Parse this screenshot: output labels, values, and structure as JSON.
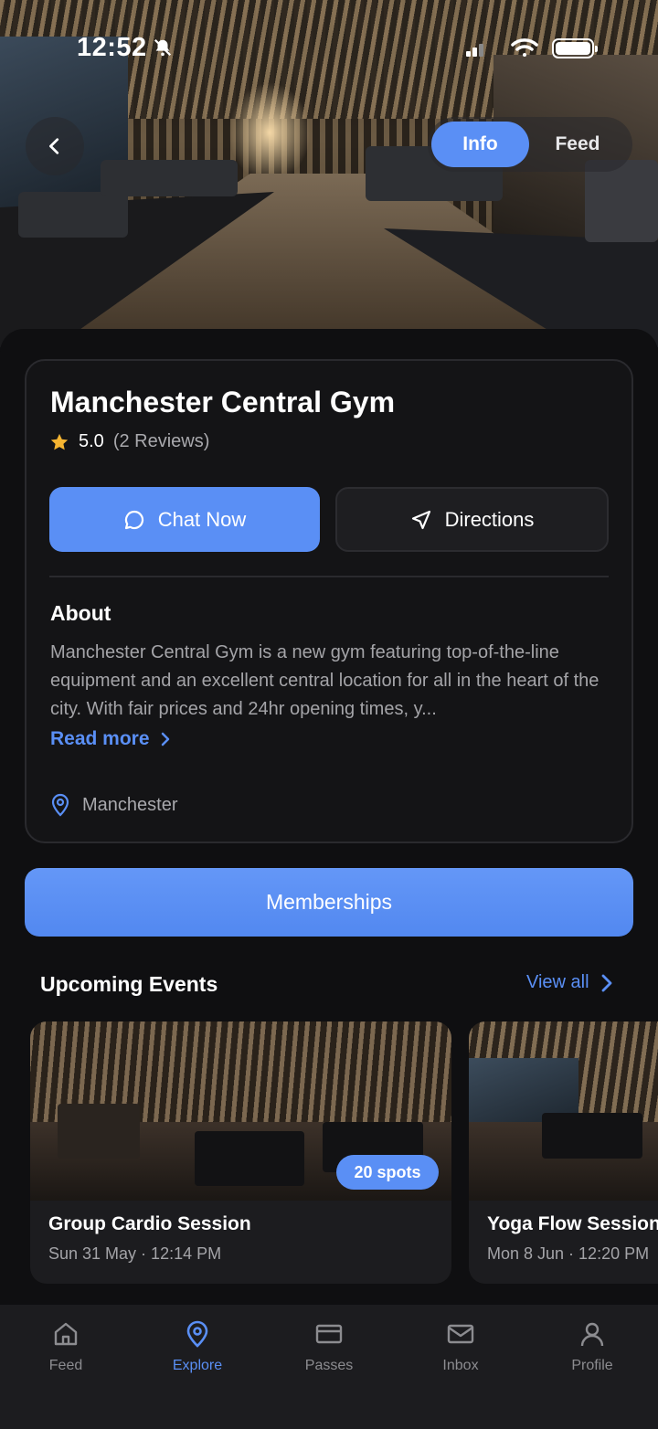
{
  "status_bar": {
    "time": "12:52"
  },
  "header": {
    "tabs": [
      {
        "label": "Info",
        "active": true
      },
      {
        "label": "Feed",
        "active": false
      }
    ]
  },
  "gym": {
    "name": "Manchester Central Gym",
    "rating": "5.0",
    "reviews": "(2 Reviews)",
    "chat_label": "Chat Now",
    "directions_label": "Directions",
    "about_title": "About",
    "about_text": "Manchester Central Gym is a new gym featuring top-of-the-line equipment and an excellent central location for all in the heart of the city. With fair prices and 24hr opening times, y...",
    "read_more": "Read more",
    "location": "Manchester"
  },
  "memberships_label": "Memberships",
  "events": {
    "title": "Upcoming Events",
    "view_all": "View all",
    "items": [
      {
        "title": "Group Cardio Session",
        "date": "Sun 31 May · 12:14 PM",
        "spots": "20 spots"
      },
      {
        "title": "Yoga Flow Session",
        "date": "Mon 8 Jun · 12:20 PM"
      }
    ]
  },
  "nav": [
    {
      "label": "Feed",
      "icon": "home-icon",
      "active": false
    },
    {
      "label": "Explore",
      "icon": "location-pin-icon",
      "active": true
    },
    {
      "label": "Passes",
      "icon": "card-icon",
      "active": false
    },
    {
      "label": "Inbox",
      "icon": "mail-icon",
      "active": false
    },
    {
      "label": "Profile",
      "icon": "user-icon",
      "active": false
    }
  ],
  "colors": {
    "accent": "#5a8ff5",
    "star": "#f5b431",
    "background": "#0f0f11"
  }
}
